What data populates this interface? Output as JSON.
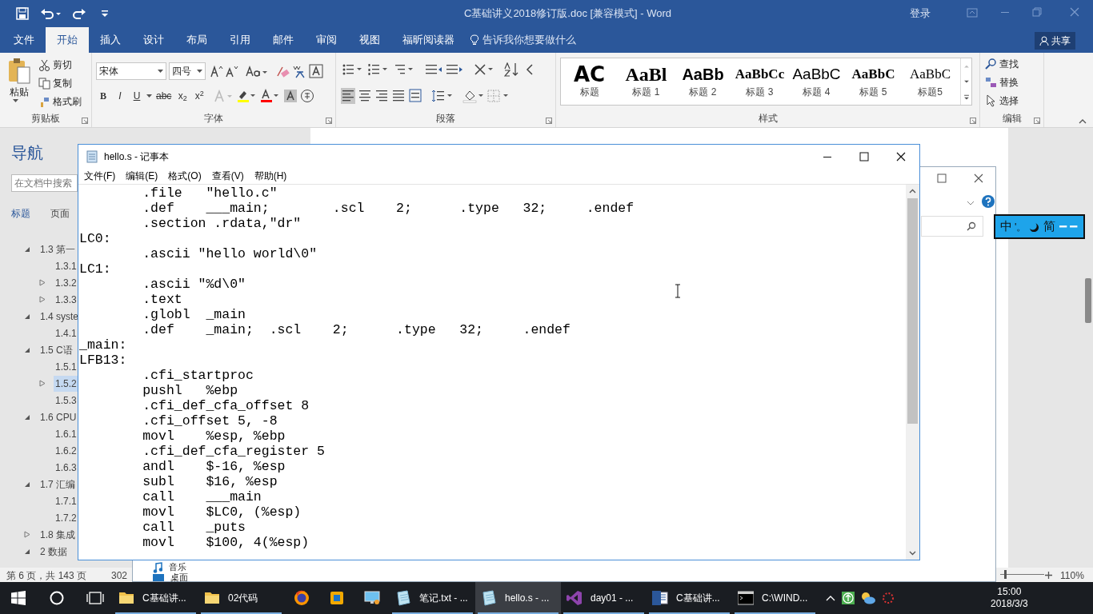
{
  "word": {
    "title": "C基础讲义2018修订版.doc [兼容模式] - Word",
    "sign_in": "登录",
    "tabs": [
      {
        "label": "文件",
        "selected": false
      },
      {
        "label": "开始",
        "selected": true
      },
      {
        "label": "插入",
        "selected": false
      },
      {
        "label": "设计",
        "selected": false
      },
      {
        "label": "布局",
        "selected": false
      },
      {
        "label": "引用",
        "selected": false
      },
      {
        "label": "邮件",
        "selected": false
      },
      {
        "label": "审阅",
        "selected": false
      },
      {
        "label": "视图",
        "selected": false
      },
      {
        "label": "福昕阅读器",
        "selected": false
      }
    ],
    "tell_me": "告诉我你想要做什么",
    "share": "共享",
    "clipboard": {
      "paste": "粘贴",
      "items": [
        "剪切",
        "复制",
        "格式刷"
      ],
      "label": "剪贴板"
    },
    "font": {
      "name": "宋体",
      "size": "四号",
      "format_buttons": [
        "B",
        "I",
        "U",
        "abc",
        "x$_{2}$",
        "x$^{2}$"
      ],
      "label": "字体"
    },
    "paragraph": {
      "align_buttons": [
        {
          "selected": true
        },
        {
          "selected": false
        },
        {
          "selected": false
        },
        {
          "selected": false
        },
        {
          "selected": false
        }
      ],
      "label": "段落"
    },
    "styles": {
      "items": [
        {
          "preview": "AC",
          "label": "标题"
        },
        {
          "preview": "AaBl",
          "label": "标题 1"
        },
        {
          "preview": "AaBb",
          "label": "标题 2"
        },
        {
          "preview": "AaBbCc",
          "label": "标题 3"
        },
        {
          "preview": "AaBbC",
          "label": "标题 4"
        },
        {
          "preview": "AaBbC",
          "label": "标题 5"
        },
        {
          "preview": "AaBbC",
          "label": "标题5"
        }
      ],
      "label": "样式"
    },
    "editing": {
      "items": [
        "查找",
        "替换",
        "选择"
      ],
      "label": "编辑"
    }
  },
  "navigation": {
    "title": "导航",
    "search_placeholder": "在文档中搜索",
    "tabs": [
      {
        "label": "标题",
        "selected": true
      },
      {
        "label": "页面",
        "selected": false
      }
    ],
    "tree": [
      {
        "label": "1.3 第一",
        "expanded": true,
        "selected": false,
        "children": [
          {
            "label": "1.3.1",
            "selected": false
          },
          {
            "label": "1.3.2",
            "expanded": false,
            "selected": false
          },
          {
            "label": "1.3.3",
            "expanded": false,
            "selected": false
          }
        ]
      },
      {
        "label": "1.4 syste",
        "expanded": true,
        "selected": false,
        "children": [
          {
            "label": "1.4.1",
            "selected": false
          }
        ]
      },
      {
        "label": "1.5 C语",
        "expanded": true,
        "selected": false,
        "children": [
          {
            "label": "1.5.1",
            "selected": false
          },
          {
            "label": "1.5.2",
            "expanded": false,
            "selected": true
          },
          {
            "label": "1.5.3",
            "selected": false
          }
        ]
      },
      {
        "label": "1.6 CPU",
        "expanded": true,
        "selected": false,
        "children": [
          {
            "label": "1.6.1",
            "selected": false
          },
          {
            "label": "1.6.2",
            "selected": false
          },
          {
            "label": "1.6.3",
            "selected": false
          }
        ]
      },
      {
        "label": "1.7 汇编",
        "expanded": true,
        "selected": false,
        "children": [
          {
            "label": "1.7.1",
            "selected": false
          },
          {
            "label": "1.7.2",
            "selected": false
          }
        ]
      },
      {
        "label": "1.8 集成",
        "expanded": false,
        "selected": false
      },
      {
        "label": "2 数据",
        "expanded": true,
        "selected": false
      }
    ]
  },
  "status_bar": {
    "page": "第 6 页，共 143 页",
    "words": "302",
    "zoom": "110%",
    "zoom_slider": {
      "level": 0.1
    }
  },
  "explorer": {
    "items": [
      "音乐",
      "桌面"
    ]
  },
  "notepad": {
    "title": "hello.s - 记事本",
    "menu": [
      "文件(F)",
      "编辑(E)",
      "格式(O)",
      "查看(V)",
      "帮助(H)"
    ],
    "lines": [
      "\t.file\t\"hello.c\"",
      "\t.def\t___main;\t.scl\t2;\t.type\t32;\t.endef",
      "\t.section .rdata,\"dr\"",
      "LC0:",
      "\t.ascii \"hello world\\0\"",
      "LC1:",
      "\t.ascii \"%d\\0\"",
      "\t.text",
      "\t.globl\t_main",
      "\t.def\t_main;\t.scl\t2;\t.type\t32;\t.endef",
      "_main:",
      "LFB13:",
      "\t.cfi_startproc",
      "\tpushl\t%ebp",
      "\t.cfi_def_cfa_offset 8",
      "\t.cfi_offset 5, -8",
      "\tmovl\t%esp, %ebp",
      "\t.cfi_def_cfa_register 5",
      "\tandl\t$-16, %esp",
      "\tsubl\t$16, %esp",
      "\tcall\t___main",
      "\tmovl\t$LC0, (%esp)",
      "\tcall\t_puts",
      "\tmovl\t$100, 4(%esp)"
    ]
  },
  "ime": {
    "mode": "中",
    "punctuation": "'。",
    "script": "简"
  },
  "taskbar": {
    "apps": [
      {
        "kind": "folder",
        "label": "C基础讲...",
        "open": true,
        "active": false
      },
      {
        "kind": "folder",
        "label": "02代码",
        "open": true,
        "active": false
      },
      {
        "kind": "browser",
        "open": false,
        "active": false
      },
      {
        "kind": "vm",
        "open": false,
        "active": false
      },
      {
        "kind": "remote",
        "open": false,
        "active": false
      },
      {
        "kind": "notepad",
        "label": "笔记.txt - ...",
        "open": true,
        "active": false
      },
      {
        "kind": "notepad",
        "label": "hello.s - ...",
        "open": true,
        "active": true
      },
      {
        "kind": "studio",
        "label": "day01 - ...",
        "open": true,
        "active": false
      },
      {
        "kind": "word",
        "label": "C基础讲...",
        "open": true,
        "active": false
      },
      {
        "kind": "console",
        "label": "C:\\WIND...",
        "open": true,
        "active": false
      }
    ],
    "time": "15:00",
    "date": "2018/3/3"
  }
}
